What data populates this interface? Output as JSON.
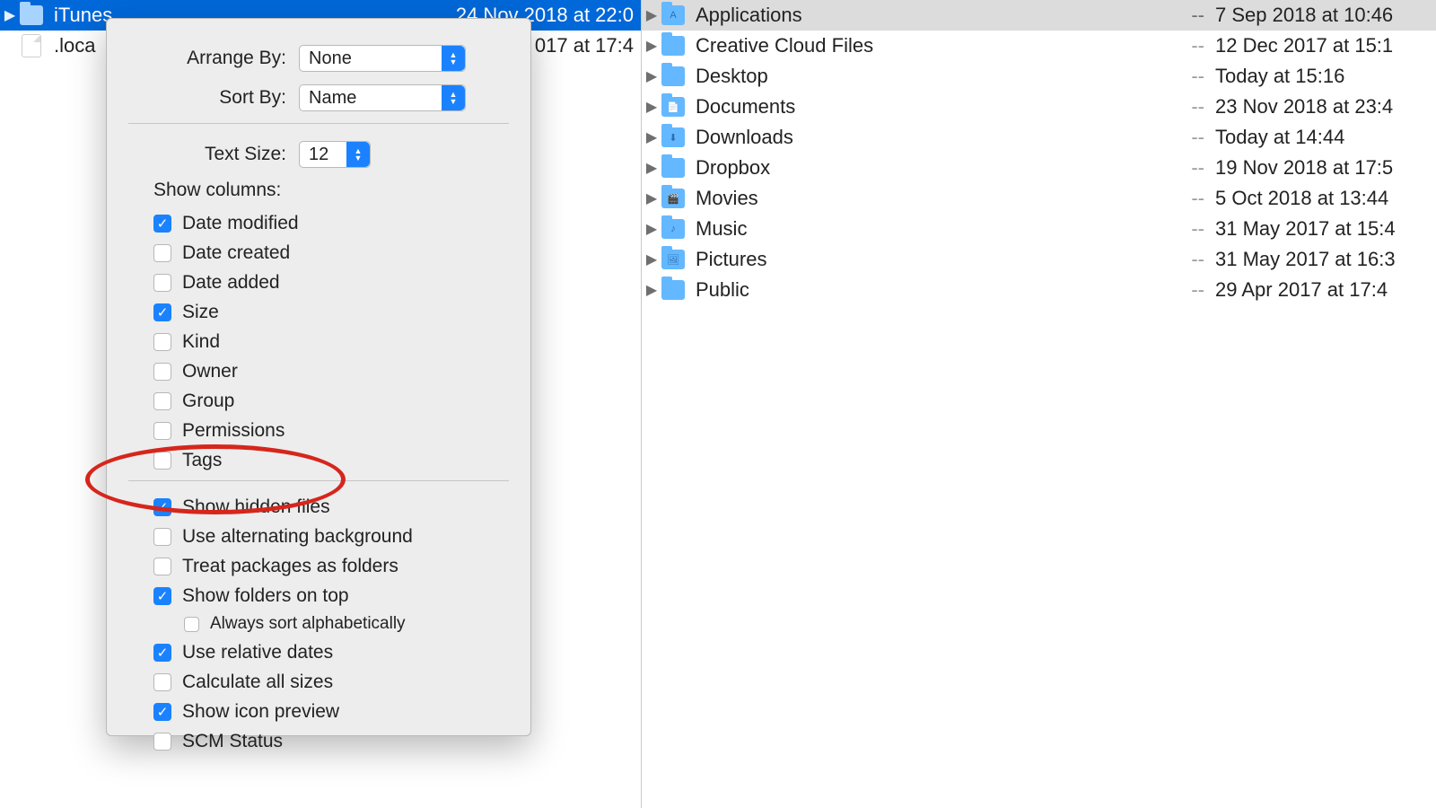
{
  "left_pane": {
    "selected": {
      "name": "iTunes",
      "size": "",
      "date": "24 Nov 2018 at 22:0"
    },
    "rows": [
      {
        "name": ".loca",
        "size": "",
        "date": "017 at 17:4",
        "display_date_fragment": "017 at 17:4"
      }
    ]
  },
  "right_pane": {
    "rows": [
      {
        "name": "Applications",
        "date": "7 Sep 2018 at 10:46",
        "selected": true
      },
      {
        "name": "Creative Cloud Files",
        "date": "12 Dec 2017 at 15:1"
      },
      {
        "name": "Desktop",
        "date": "Today at 15:16"
      },
      {
        "name": "Documents",
        "date": "23 Nov 2018 at 23:4"
      },
      {
        "name": "Downloads",
        "date": "Today at 14:44"
      },
      {
        "name": "Dropbox",
        "date": "19 Nov 2018 at 17:5"
      },
      {
        "name": "Movies",
        "date": "5 Oct 2018 at 13:44"
      },
      {
        "name": "Music",
        "date": "31 May 2017 at 15:4"
      },
      {
        "name": "Pictures",
        "date": "31 May 2017 at 16:3"
      },
      {
        "name": "Public",
        "date": "29 Apr 2017 at 17:4"
      }
    ],
    "size_placeholder": "--"
  },
  "panel": {
    "arrange_by": {
      "label": "Arrange By:",
      "value": "None"
    },
    "sort_by": {
      "label": "Sort By:",
      "value": "Name"
    },
    "text_size": {
      "label": "Text Size:",
      "value": "12"
    },
    "columns_heading": "Show columns:",
    "columns": [
      {
        "label": "Date modified",
        "checked": true
      },
      {
        "label": "Date created",
        "checked": false
      },
      {
        "label": "Date added",
        "checked": false
      },
      {
        "label": "Size",
        "checked": true
      },
      {
        "label": "Kind",
        "checked": false
      },
      {
        "label": "Owner",
        "checked": false
      },
      {
        "label": "Group",
        "checked": false
      },
      {
        "label": "Permissions",
        "checked": false
      },
      {
        "label": "Tags",
        "checked": false
      }
    ],
    "extra": [
      {
        "label": "Show hidden files",
        "checked": true
      },
      {
        "label": "Use alternating background",
        "checked": false
      },
      {
        "label": "Treat packages as folders",
        "checked": false
      },
      {
        "label": "Show folders on top",
        "checked": true
      },
      {
        "label": "Always sort alphabetically",
        "checked": false,
        "sub": true
      },
      {
        "label": "Use relative dates",
        "checked": true
      },
      {
        "label": "Calculate all sizes",
        "checked": false
      },
      {
        "label": "Show icon preview",
        "checked": true
      },
      {
        "label": "SCM Status",
        "checked": false
      }
    ]
  }
}
